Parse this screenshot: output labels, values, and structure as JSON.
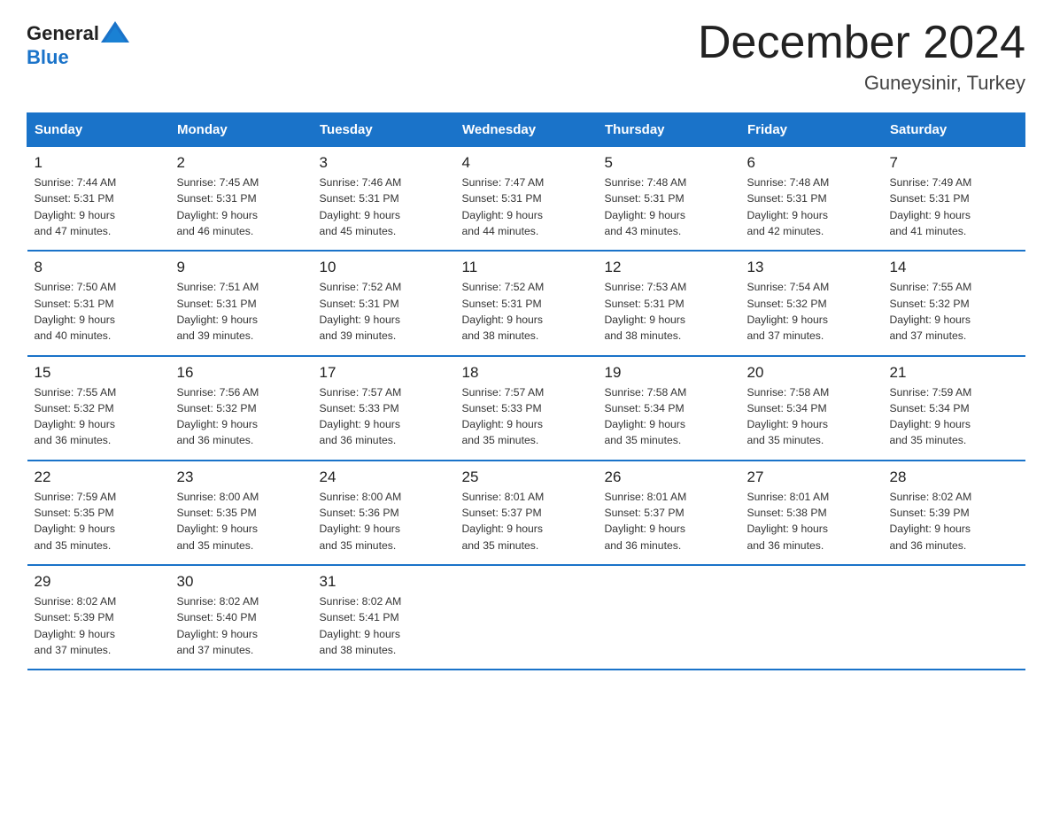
{
  "header": {
    "logo_general": "General",
    "logo_blue": "Blue",
    "month_title": "December 2024",
    "location": "Guneysinir, Turkey"
  },
  "days_of_week": [
    "Sunday",
    "Monday",
    "Tuesday",
    "Wednesday",
    "Thursday",
    "Friday",
    "Saturday"
  ],
  "weeks": [
    [
      {
        "day": "1",
        "sunrise": "7:44 AM",
        "sunset": "5:31 PM",
        "daylight": "9 hours and 47 minutes."
      },
      {
        "day": "2",
        "sunrise": "7:45 AM",
        "sunset": "5:31 PM",
        "daylight": "9 hours and 46 minutes."
      },
      {
        "day": "3",
        "sunrise": "7:46 AM",
        "sunset": "5:31 PM",
        "daylight": "9 hours and 45 minutes."
      },
      {
        "day": "4",
        "sunrise": "7:47 AM",
        "sunset": "5:31 PM",
        "daylight": "9 hours and 44 minutes."
      },
      {
        "day": "5",
        "sunrise": "7:48 AM",
        "sunset": "5:31 PM",
        "daylight": "9 hours and 43 minutes."
      },
      {
        "day": "6",
        "sunrise": "7:48 AM",
        "sunset": "5:31 PM",
        "daylight": "9 hours and 42 minutes."
      },
      {
        "day": "7",
        "sunrise": "7:49 AM",
        "sunset": "5:31 PM",
        "daylight": "9 hours and 41 minutes."
      }
    ],
    [
      {
        "day": "8",
        "sunrise": "7:50 AM",
        "sunset": "5:31 PM",
        "daylight": "9 hours and 40 minutes."
      },
      {
        "day": "9",
        "sunrise": "7:51 AM",
        "sunset": "5:31 PM",
        "daylight": "9 hours and 39 minutes."
      },
      {
        "day": "10",
        "sunrise": "7:52 AM",
        "sunset": "5:31 PM",
        "daylight": "9 hours and 39 minutes."
      },
      {
        "day": "11",
        "sunrise": "7:52 AM",
        "sunset": "5:31 PM",
        "daylight": "9 hours and 38 minutes."
      },
      {
        "day": "12",
        "sunrise": "7:53 AM",
        "sunset": "5:31 PM",
        "daylight": "9 hours and 38 minutes."
      },
      {
        "day": "13",
        "sunrise": "7:54 AM",
        "sunset": "5:32 PM",
        "daylight": "9 hours and 37 minutes."
      },
      {
        "day": "14",
        "sunrise": "7:55 AM",
        "sunset": "5:32 PM",
        "daylight": "9 hours and 37 minutes."
      }
    ],
    [
      {
        "day": "15",
        "sunrise": "7:55 AM",
        "sunset": "5:32 PM",
        "daylight": "9 hours and 36 minutes."
      },
      {
        "day": "16",
        "sunrise": "7:56 AM",
        "sunset": "5:32 PM",
        "daylight": "9 hours and 36 minutes."
      },
      {
        "day": "17",
        "sunrise": "7:57 AM",
        "sunset": "5:33 PM",
        "daylight": "9 hours and 36 minutes."
      },
      {
        "day": "18",
        "sunrise": "7:57 AM",
        "sunset": "5:33 PM",
        "daylight": "9 hours and 35 minutes."
      },
      {
        "day": "19",
        "sunrise": "7:58 AM",
        "sunset": "5:34 PM",
        "daylight": "9 hours and 35 minutes."
      },
      {
        "day": "20",
        "sunrise": "7:58 AM",
        "sunset": "5:34 PM",
        "daylight": "9 hours and 35 minutes."
      },
      {
        "day": "21",
        "sunrise": "7:59 AM",
        "sunset": "5:34 PM",
        "daylight": "9 hours and 35 minutes."
      }
    ],
    [
      {
        "day": "22",
        "sunrise": "7:59 AM",
        "sunset": "5:35 PM",
        "daylight": "9 hours and 35 minutes."
      },
      {
        "day": "23",
        "sunrise": "8:00 AM",
        "sunset": "5:35 PM",
        "daylight": "9 hours and 35 minutes."
      },
      {
        "day": "24",
        "sunrise": "8:00 AM",
        "sunset": "5:36 PM",
        "daylight": "9 hours and 35 minutes."
      },
      {
        "day": "25",
        "sunrise": "8:01 AM",
        "sunset": "5:37 PM",
        "daylight": "9 hours and 35 minutes."
      },
      {
        "day": "26",
        "sunrise": "8:01 AM",
        "sunset": "5:37 PM",
        "daylight": "9 hours and 36 minutes."
      },
      {
        "day": "27",
        "sunrise": "8:01 AM",
        "sunset": "5:38 PM",
        "daylight": "9 hours and 36 minutes."
      },
      {
        "day": "28",
        "sunrise": "8:02 AM",
        "sunset": "5:39 PM",
        "daylight": "9 hours and 36 minutes."
      }
    ],
    [
      {
        "day": "29",
        "sunrise": "8:02 AM",
        "sunset": "5:39 PM",
        "daylight": "9 hours and 37 minutes."
      },
      {
        "day": "30",
        "sunrise": "8:02 AM",
        "sunset": "5:40 PM",
        "daylight": "9 hours and 37 minutes."
      },
      {
        "day": "31",
        "sunrise": "8:02 AM",
        "sunset": "5:41 PM",
        "daylight": "9 hours and 38 minutes."
      },
      null,
      null,
      null,
      null
    ]
  ]
}
